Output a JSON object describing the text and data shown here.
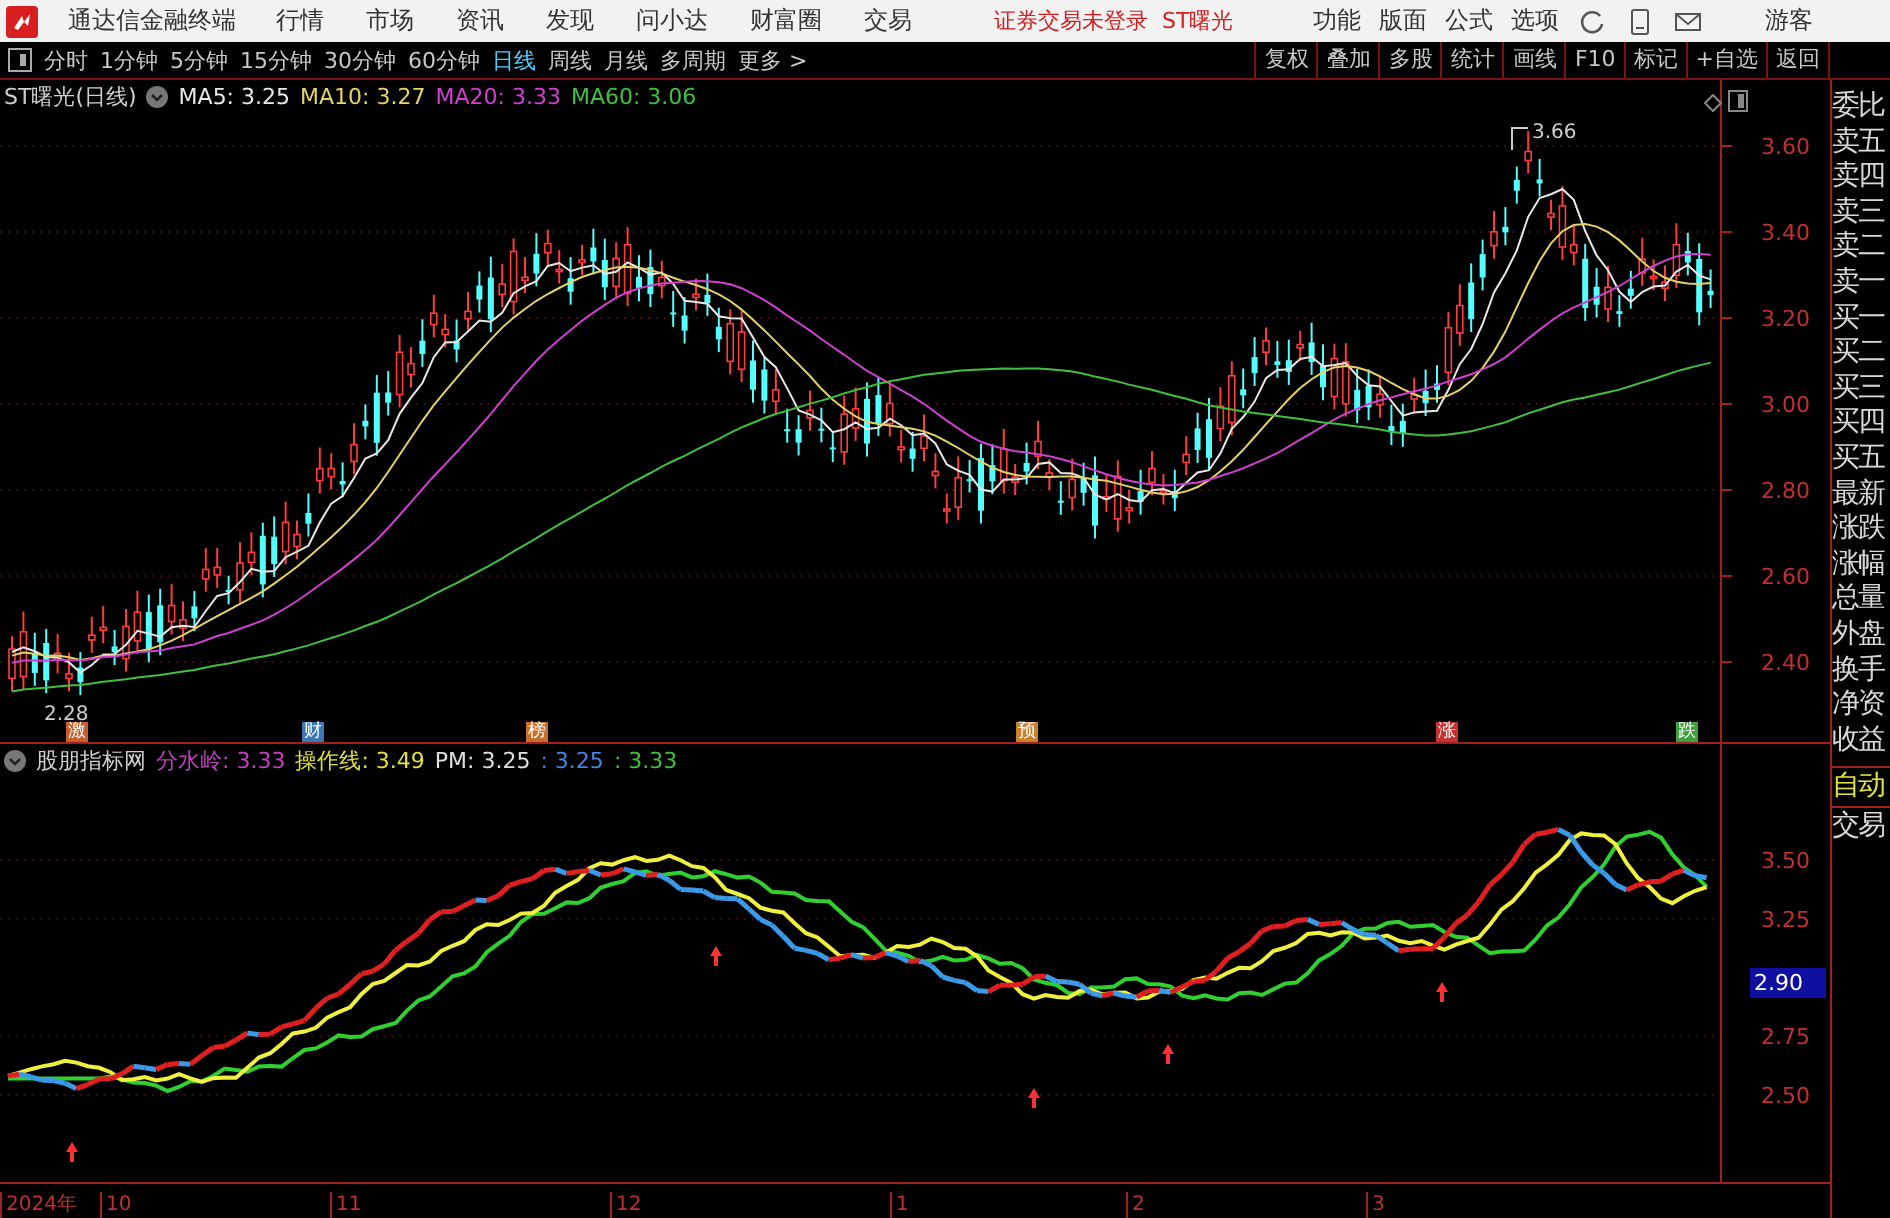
{
  "menubar": {
    "app_title": "通达信金融终端",
    "menus": [
      "行情",
      "市场",
      "资讯",
      "发现",
      "问小达",
      "财富圈",
      "交易"
    ],
    "status": "证券交易未登录  ST曙光",
    "options": [
      "功能",
      "版面",
      "公式",
      "选项"
    ],
    "user": "游客"
  },
  "periods": [
    {
      "label": "分时",
      "selected": false
    },
    {
      "label": "1分钟",
      "selected": false
    },
    {
      "label": "5分钟",
      "selected": false
    },
    {
      "label": "15分钟",
      "selected": false
    },
    {
      "label": "30分钟",
      "selected": false
    },
    {
      "label": "60分钟",
      "selected": false
    },
    {
      "label": "日线",
      "selected": true
    },
    {
      "label": "周线",
      "selected": false
    },
    {
      "label": "月线",
      "selected": false
    },
    {
      "label": "多周期",
      "selected": false
    },
    {
      "label": "更多 >",
      "selected": false
    }
  ],
  "tools": [
    "复权",
    "叠加",
    "多股",
    "统计",
    "画线",
    "F10",
    "标记",
    "+自选",
    "返回"
  ],
  "main_chart": {
    "title": "ST曙光(日线)",
    "indicators": [
      {
        "text": "MA5: 3.25",
        "color": "#e8e8e8"
      },
      {
        "text": "MA10: 3.27",
        "color": "#e6d26a"
      },
      {
        "text": "MA20: 3.33",
        "color": "#d040d0"
      },
      {
        "text": "MA60: 3.06",
        "color": "#40c040"
      }
    ],
    "yticks": [
      "3.60",
      "3.40",
      "3.20",
      "3.00",
      "2.80",
      "2.60",
      "2.40"
    ],
    "high_label": "3.66",
    "low_label": "2.28",
    "events": [
      {
        "label": "激",
        "color": "#c8602a"
      },
      {
        "label": "财",
        "color": "#3a78b8"
      },
      {
        "label": "榜",
        "color": "#c8702a"
      },
      {
        "label": "预",
        "color": "#c8802a"
      },
      {
        "label": "涨",
        "color": "#c83030"
      },
      {
        "label": "跌",
        "color": "#40a040"
      }
    ]
  },
  "indicator_panel": {
    "title": "股朋指标网",
    "values": [
      {
        "text": "分水岭: 3.33",
        "color": "#c040c0"
      },
      {
        "text": "操作线: 3.49",
        "color": "#e0e040"
      },
      {
        "text": "PM: 3.25",
        "color": "#e0e0e0"
      },
      {
        "text": ": 3.25",
        "color": "#4a80e0"
      },
      {
        "text": ": 3.33",
        "color": "#40c040"
      }
    ],
    "yticks": [
      "3.50",
      "3.25",
      "2.75",
      "2.50"
    ],
    "cursor_value": "2.90"
  },
  "x_axis": [
    "2024年",
    "10",
    "11",
    "12",
    "1",
    "2",
    "3"
  ],
  "sidebar": {
    "items": [
      "委比",
      "卖五",
      "卖四",
      "卖三",
      "卖二",
      "卖一",
      "买一",
      "买二",
      "买三",
      "买四",
      "买五",
      "最新",
      "涨跌",
      "涨幅",
      "总量",
      "外盘",
      "换手",
      "净资",
      "收益"
    ],
    "footer": [
      {
        "label": "自动",
        "kind": "mode"
      },
      {
        "label": "交易",
        "kind": "link"
      }
    ]
  }
}
